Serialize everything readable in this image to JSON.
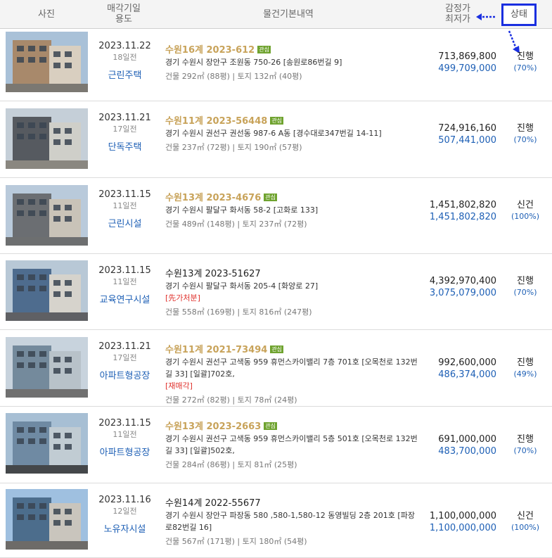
{
  "header": {
    "photo": "사진",
    "date_line1": "매각기일",
    "date_line2": "용도",
    "info": "물건기본내역",
    "price_line1": "감정가",
    "price_line2": "최저가",
    "status": "상태",
    "status_highlight_color": "#1a2fe0"
  },
  "badge_label": "관심",
  "rows": [
    {
      "date": "2023.11.22",
      "ago": "18일전",
      "use": "근린주택",
      "case": "수원16계 2023-612",
      "favorite": true,
      "address": "경기 수원시 장안구 조원동 750-26 [송원로86번길 9]",
      "tag": "",
      "area": "건물 292㎡ (88평)  |  토지 132㎡ (40평)",
      "appraisal": "713,869,800",
      "minimum": "499,709,000",
      "status": "진행",
      "percent": "(70%)"
    },
    {
      "date": "2023.11.21",
      "ago": "17일전",
      "use": "단독주택",
      "case": "수원11계 2023-56448",
      "favorite": true,
      "address": "경기 수원시 권선구 권선동 987-6 A동 [경수대로347번길 14-11]",
      "tag": "",
      "area": "건물 237㎡ (72평)  |  토지 190㎡ (57평)",
      "appraisal": "724,916,160",
      "minimum": "507,441,000",
      "status": "진행",
      "percent": "(70%)"
    },
    {
      "date": "2023.11.15",
      "ago": "11일전",
      "use": "근린시설",
      "case": "수원13계 2023-4676",
      "favorite": true,
      "address": "경기 수원시 팔달구 화서동 58-2 [고화로 133]",
      "tag": "",
      "area": "건물 489㎡ (148평)  |  토지 237㎡ (72평)",
      "appraisal": "1,451,802,820",
      "minimum": "1,451,802,820",
      "status": "신건",
      "percent": "(100%)"
    },
    {
      "date": "2023.11.15",
      "ago": "11일전",
      "use": "교육연구시설",
      "case": "수원13계 2023-51627",
      "favorite": false,
      "address": "경기 수원시 팔달구 화서동 205-4 [화양로 27]",
      "tag": "[先가처분]",
      "area": "건물 558㎡ (169평)  |  토지 816㎡ (247평)",
      "appraisal": "4,392,970,400",
      "minimum": "3,075,079,000",
      "status": "진행",
      "percent": "(70%)"
    },
    {
      "date": "2023.11.21",
      "ago": "17일전",
      "use": "아파트형공장",
      "case": "수원11계 2021-73494",
      "favorite": true,
      "address": "경기 수원시 권선구 고색동 959 휴먼스카이밸리 7층 701호 [오목천로 132번길 33] [일괄]702호,",
      "tag": "[재매각]",
      "area": "건물 272㎡ (82평)  |  토지 78㎡ (24평)",
      "appraisal": "992,600,000",
      "minimum": "486,374,000",
      "status": "진행",
      "percent": "(49%)"
    },
    {
      "date": "2023.11.15",
      "ago": "11일전",
      "use": "아파트형공장",
      "case": "수원13계 2023-2663",
      "favorite": true,
      "address": "경기 수원시 권선구 고색동 959 휴먼스카이밸리 5층 501호 [오목천로 132번길 33] [일괄]502호,",
      "tag": "",
      "area": "건물 284㎡ (86평)  |  토지 81㎡ (25평)",
      "appraisal": "691,000,000",
      "minimum": "483,700,000",
      "status": "진행",
      "percent": "(70%)"
    },
    {
      "date": "2023.11.16",
      "ago": "12일전",
      "use": "노유자시설",
      "case": "수원14계 2022-55677",
      "favorite": false,
      "address": "경기 수원시 장안구 파장동 580 ,580-1,580-12 동영빌딩 2층 201호 [파장로82번길 16]",
      "tag": "",
      "area": "건물 567㎡ (171평)  |  토지 180㎡ (54평)",
      "appraisal": "1,100,000,000",
      "minimum": "1,100,000,000",
      "status": "신건",
      "percent": "(100%)"
    }
  ]
}
